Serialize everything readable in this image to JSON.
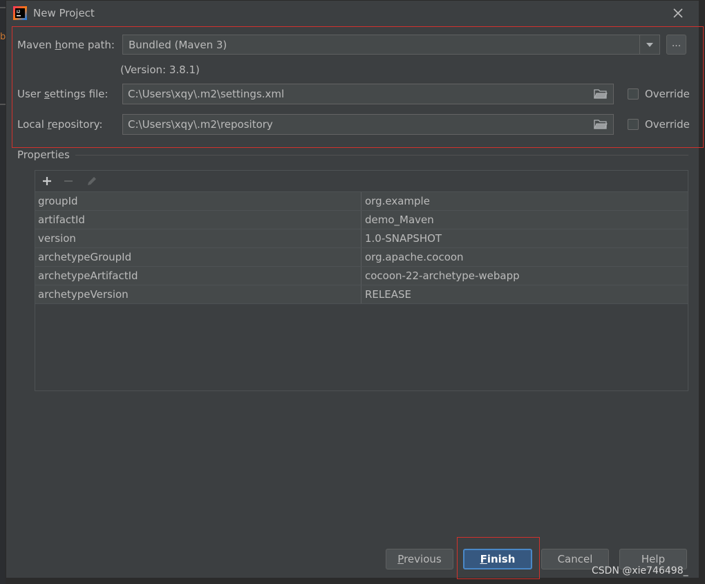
{
  "window": {
    "title": "New Project",
    "app_icon": "intellij-idea-icon",
    "close_icon": "close-icon"
  },
  "background_edge": {
    "letter": "b"
  },
  "maven": {
    "home_label_pre": "Maven ",
    "home_label_mnemonic": "h",
    "home_label_post": "ome path:",
    "home_value": "Bundled (Maven 3)",
    "browse_label": "...",
    "version_text": "(Version: 3.8.1)",
    "settings_label_pre": "User ",
    "settings_label_mnemonic": "s",
    "settings_label_post": "ettings file:",
    "settings_value": "C:\\Users\\xqy\\.m2\\settings.xml",
    "repo_label_pre": "Local ",
    "repo_label_mnemonic": "r",
    "repo_label_post": "epository:",
    "repo_value": "C:\\Users\\xqy\\.m2\\repository",
    "override_label": "Override",
    "settings_override_checked": false,
    "repo_override_checked": false
  },
  "properties": {
    "section_label": "Properties",
    "toolbar": {
      "add_icon": "plus-icon",
      "remove_icon": "minus-icon",
      "edit_icon": "pencil-icon"
    },
    "rows": [
      {
        "key": "groupId",
        "value": "org.example"
      },
      {
        "key": "artifactId",
        "value": "demo_Maven"
      },
      {
        "key": "version",
        "value": "1.0-SNAPSHOT"
      },
      {
        "key": "archetypeGroupId",
        "value": "org.apache.cocoon"
      },
      {
        "key": "archetypeArtifactId",
        "value": "cocoon-22-archetype-webapp"
      },
      {
        "key": "archetypeVersion",
        "value": "RELEASE"
      }
    ]
  },
  "buttons": {
    "previous_mnemonic": "P",
    "previous_rest": "revious",
    "finish_mnemonic": "F",
    "finish_rest": "inish",
    "cancel": "Cancel",
    "help": "Help"
  },
  "watermark": "CSDN @xie746498_",
  "colors": {
    "highlight": "#d2322d",
    "primary_button": "#365880",
    "dialog_bg": "#3c3f41"
  }
}
